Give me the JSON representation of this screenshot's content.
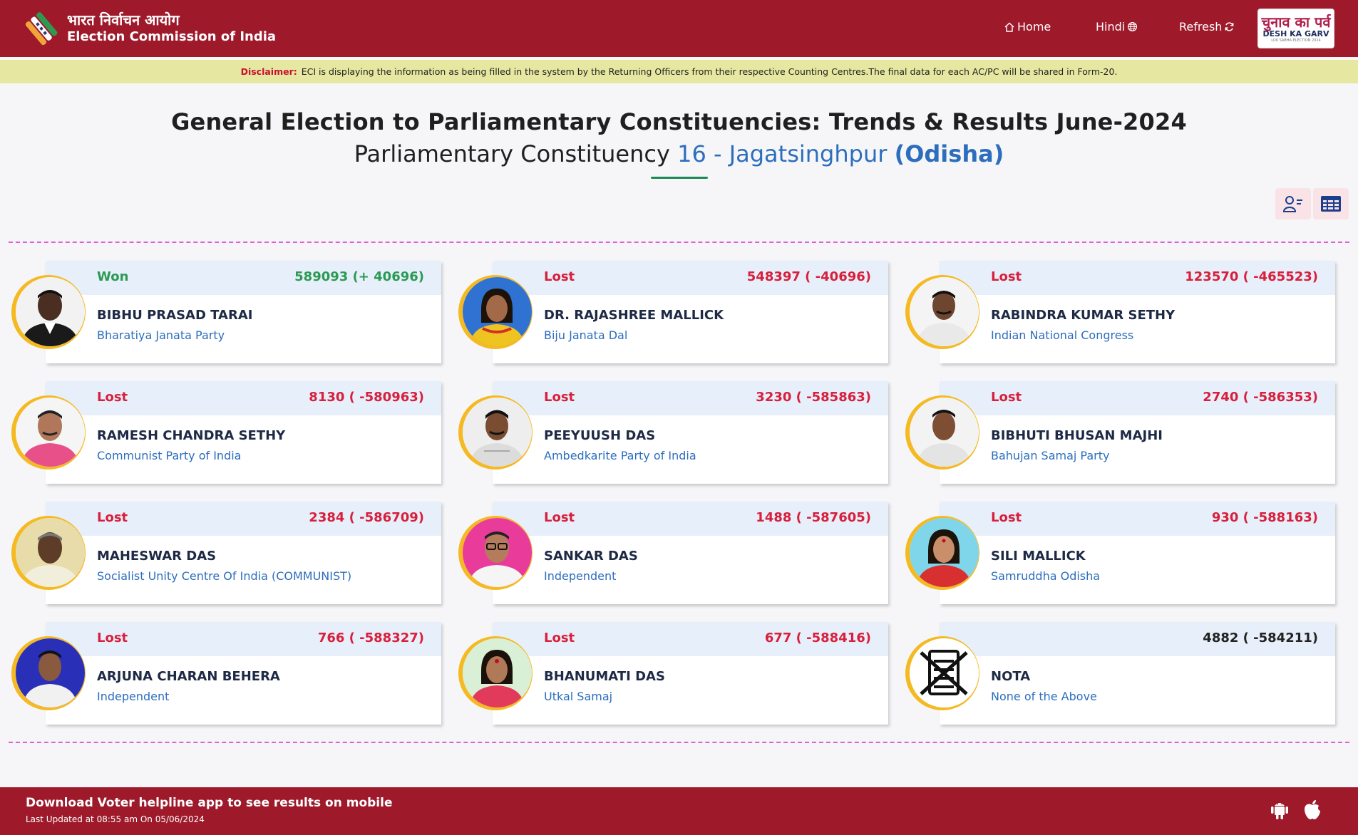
{
  "header": {
    "logo_hindi": "भारत निर्वाचन आयोग",
    "logo_english": "Election Commission of India",
    "nav": {
      "home": "Home",
      "hindi": "Hindi",
      "refresh": "Refresh"
    },
    "badge": {
      "hindi": "चुनाव का पर्व",
      "english": "DESH KA GARV",
      "sub": "LOK SABHA ELECTION 2024"
    }
  },
  "disclaimer": {
    "label": "Disclaimer:",
    "text": "ECI is displaying the information as being filled in the system by the Returning Officers from their respective Counting Centres.The final data for each AC/PC will be shared in Form-20."
  },
  "title": {
    "line1": "General Election to Parliamentary Constituencies: Trends & Results June-2024",
    "line2_prefix": "Parliamentary Constituency",
    "constituency": "16 - Jagatsinghpur",
    "state": "(Odisha)"
  },
  "candidates": [
    {
      "status": "Won",
      "votes": "589093 (+ 40696)",
      "name": "BIBHU PRASAD TARAI",
      "party": "Bharatiya Janata Party",
      "result": "won"
    },
    {
      "status": "Lost",
      "votes": "548397 ( -40696)",
      "name": "DR. RAJASHREE MALLICK",
      "party": "Biju Janata Dal",
      "result": "lost"
    },
    {
      "status": "Lost",
      "votes": "123570 ( -465523)",
      "name": "RABINDRA KUMAR SETHY",
      "party": "Indian National Congress",
      "result": "lost"
    },
    {
      "status": "Lost",
      "votes": "8130 ( -580963)",
      "name": "RAMESH CHANDRA SETHY",
      "party": "Communist Party of India",
      "result": "lost"
    },
    {
      "status": "Lost",
      "votes": "3230 ( -585863)",
      "name": "PEEYUUSH DAS",
      "party": "Ambedkarite Party of India",
      "result": "lost"
    },
    {
      "status": "Lost",
      "votes": "2740 ( -586353)",
      "name": "BIBHUTI BHUSAN MAJHI",
      "party": "Bahujan Samaj Party",
      "result": "lost"
    },
    {
      "status": "Lost",
      "votes": "2384 ( -586709)",
      "name": "MAHESWAR DAS",
      "party": "Socialist Unity Centre Of India (COMMUNIST)",
      "result": "lost"
    },
    {
      "status": "Lost",
      "votes": "1488 ( -587605)",
      "name": "SANKAR DAS",
      "party": "Independent",
      "result": "lost"
    },
    {
      "status": "Lost",
      "votes": "930 ( -588163)",
      "name": "SILI MALLICK",
      "party": "Samruddha Odisha",
      "result": "lost"
    },
    {
      "status": "Lost",
      "votes": "766 ( -588327)",
      "name": "ARJUNA CHARAN BEHERA",
      "party": "Independent",
      "result": "lost"
    },
    {
      "status": "Lost",
      "votes": "677 ( -588416)",
      "name": "BHANUMATI DAS",
      "party": "Utkal Samaj",
      "result": "lost"
    },
    {
      "status": "",
      "votes": "4882 ( -584211)",
      "name": "NOTA",
      "party": "None of the Above",
      "result": "neutral"
    }
  ],
  "footer": {
    "title": "Download Voter helpline app to see results on mobile",
    "updated": "Last Updated at 08:55 am On 05/06/2024"
  },
  "colors": {
    "header_bg": "#9e1a2b",
    "disclaimer_bg": "#e6e7a0",
    "won": "#2b9a52",
    "lost": "#d81f3b",
    "party_blue": "#2c6ebd",
    "ring": "#f5b921"
  }
}
